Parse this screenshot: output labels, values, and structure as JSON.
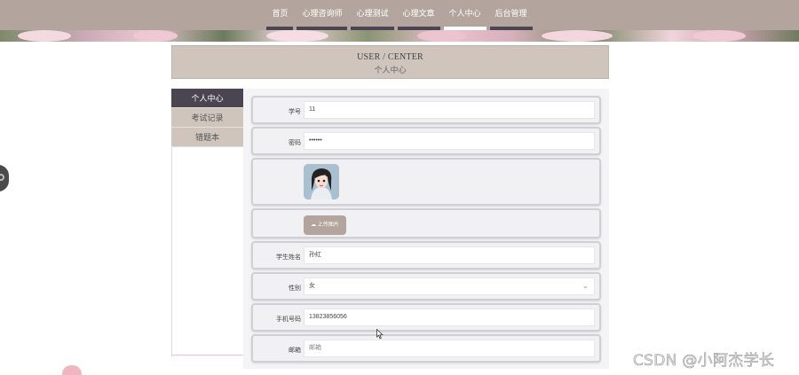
{
  "nav": {
    "items": [
      {
        "label": "首页"
      },
      {
        "label": "心理咨询师"
      },
      {
        "label": "心理测试"
      },
      {
        "label": "心理文章"
      },
      {
        "label": "个人中心"
      },
      {
        "label": "后台管理"
      }
    ],
    "active_index": 4
  },
  "header": {
    "title_en": "USER / CENTER",
    "title_cn": "个人中心"
  },
  "sidebar": {
    "items": [
      {
        "label": "个人中心"
      },
      {
        "label": "考试记录"
      },
      {
        "label": "错题本"
      }
    ],
    "active_index": 0
  },
  "form": {
    "student_id": {
      "label": "学号",
      "value": "11"
    },
    "password": {
      "label": "密码",
      "value": "••••••"
    },
    "avatar": {
      "label": ""
    },
    "upload": {
      "label": "上传图片",
      "icon": "cloud-upload-icon"
    },
    "student_name": {
      "label": "学生姓名",
      "value": "孙红"
    },
    "gender": {
      "label": "性别",
      "value": "女"
    },
    "phone": {
      "label": "手机号码",
      "value": "13823856056"
    },
    "email": {
      "label": "邮箱",
      "value": "邮箱"
    }
  },
  "watermark": "CSDN @小阿杰学长",
  "colors": {
    "nav_bg": "#b3a59d",
    "accent_dark": "#4a4550",
    "panel_bg": "#cfc5bd"
  }
}
